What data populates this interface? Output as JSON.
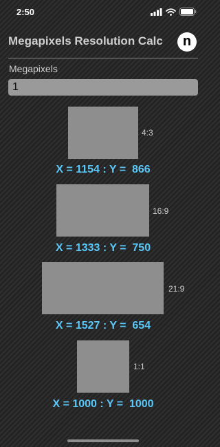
{
  "status": {
    "time": "2:50"
  },
  "app": {
    "title": "Megapixels Resolution Calc",
    "logo_letter": "n"
  },
  "input": {
    "label": "Megapixels",
    "value": "1"
  },
  "ratios": [
    {
      "label": "4:3",
      "result": "X = 1154 : Y =  866"
    },
    {
      "label": "16:9",
      "result": "X = 1333 : Y =  750"
    },
    {
      "label": "21:9",
      "result": "X = 1527 : Y =  654"
    },
    {
      "label": "1:1",
      "result": "X = 1000 : Y =  1000"
    }
  ],
  "colors": {
    "accent": "#5ac8fa",
    "box": "#8e8e8e",
    "input_bg": "#9a9a9a"
  },
  "icons": [
    "signal-icon",
    "wifi-icon",
    "battery-icon"
  ]
}
